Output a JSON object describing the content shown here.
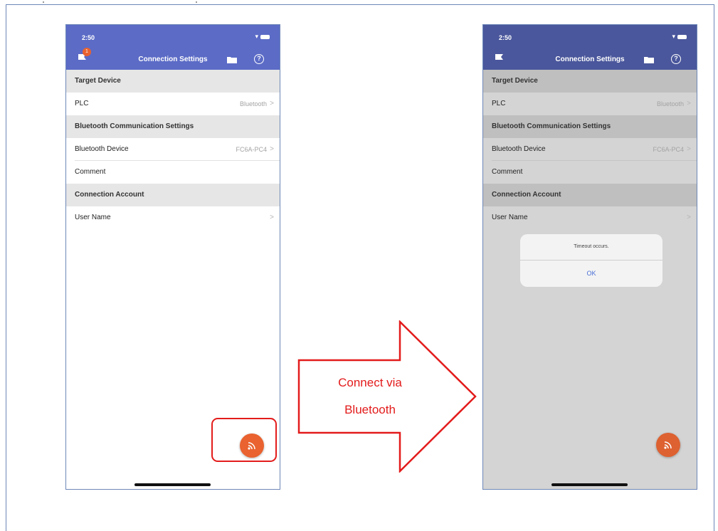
{
  "phone_left": {
    "status_time": "2:50",
    "badge_count": "1",
    "nav_title": "Connection Settings",
    "sections": {
      "target_device": "Target Device",
      "bluetooth_settings": "Bluetooth Communication Settings",
      "connection_account": "Connection Account"
    },
    "rows": {
      "plc_label": "PLC",
      "plc_value": "Bluetooth",
      "bt_device_label": "Bluetooth Device",
      "bt_device_value": "FC6A-PC4",
      "comment_label": "Comment",
      "user_name_label": "User Name"
    }
  },
  "phone_right": {
    "status_time": "2:50",
    "nav_title": "Connection Settings",
    "sections": {
      "target_device": "Target Device",
      "bluetooth_settings": "Bluetooth Communication Settings",
      "connection_account": "Connection Account"
    },
    "rows": {
      "plc_label": "PLC",
      "plc_value": "Bluetooth",
      "bt_device_label": "Bluetooth Device",
      "bt_device_value": "FC6A-PC4",
      "comment_label": "Comment",
      "user_name_label": "User Name"
    },
    "dialog": {
      "message": "Timeout occurs.",
      "ok_label": "OK"
    }
  },
  "arrow": {
    "line1": "Connect via",
    "line2": "Bluetooth"
  },
  "chevron_glyph": ">",
  "help_glyph": "?",
  "colors": {
    "nav_bar": "#5b6bc6",
    "fab": "#e9622f",
    "highlight": "#e31b1b",
    "dialog_button": "#4a6fd6"
  },
  "icons": [
    "flag-icon",
    "folder-icon",
    "help-icon",
    "wifi-icon",
    "battery-icon",
    "connect-icon"
  ]
}
